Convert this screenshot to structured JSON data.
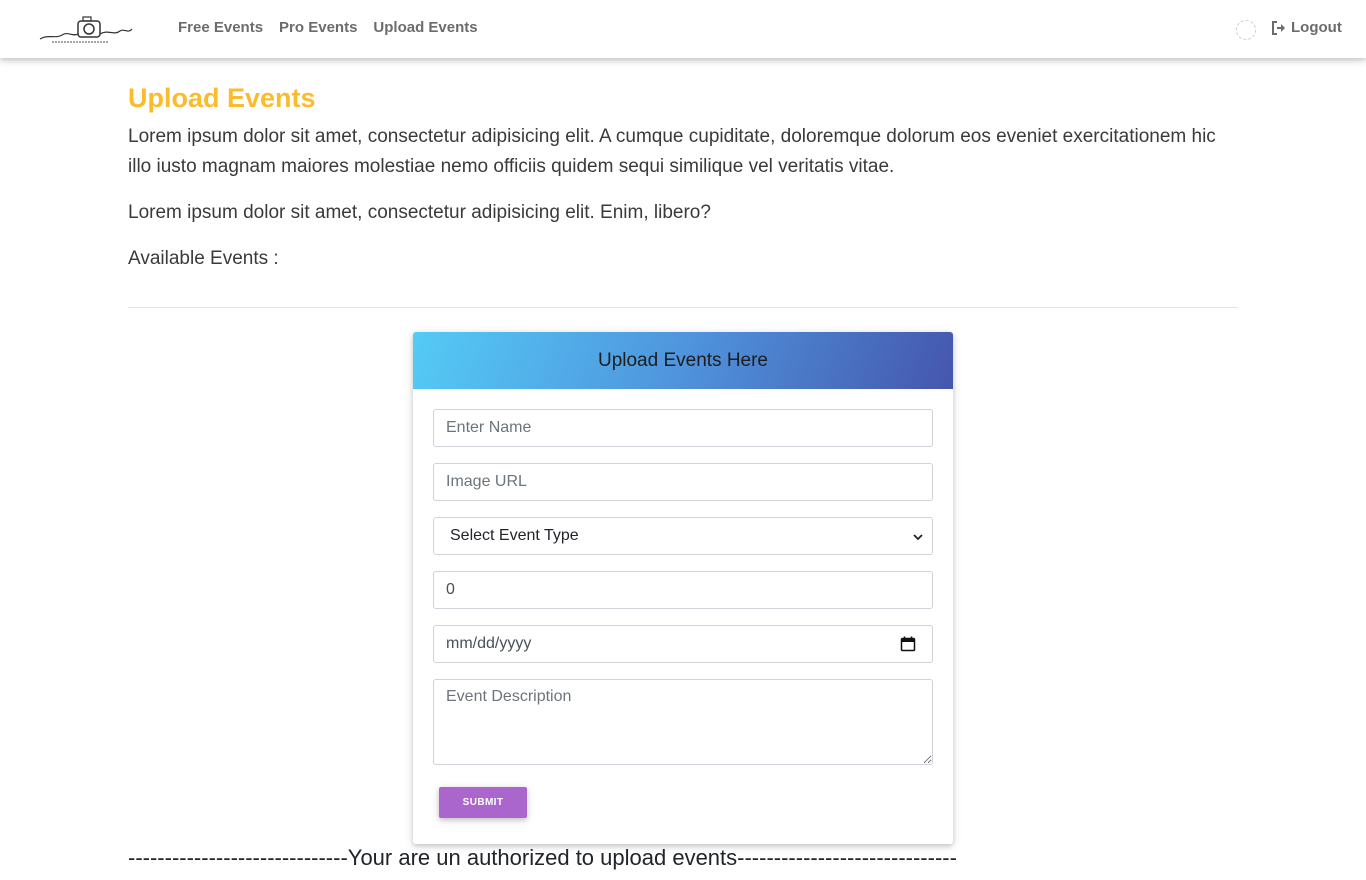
{
  "nav": {
    "logo_text": "pawan photography",
    "links": [
      {
        "label": "Free Events"
      },
      {
        "label": "Pro Events"
      },
      {
        "label": "Upload Events"
      }
    ],
    "avatar_icon": "avatar-placeholder-icon",
    "logout_label": "Logout",
    "logout_icon": "sign-out-icon"
  },
  "page": {
    "title": "Upload Events",
    "paragraph1": "Lorem ipsum dolor sit amet, consectetur adipisicing elit. A cumque cupiditate, doloremque dolorum eos eveniet exercitationem hic illo iusto magnam maiores molestiae nemo officiis quidem sequi similique vel veritatis vitae.",
    "paragraph2": "Lorem ipsum dolor sit amet, consectetur adipisicing elit. Enim, libero?",
    "paragraph3": "Available Events :"
  },
  "form": {
    "header": "Upload Events Here",
    "name_placeholder": "Enter Name",
    "image_placeholder": "Image URL",
    "event_type_selected": "Select Event Type",
    "price_value": "0",
    "date_placeholder": "mm/dd/yyyy",
    "description_placeholder": "Event Description",
    "submit_label": "SUBMIT"
  },
  "footer_message": "------------------------------Your are un authorized to upload events------------------------------",
  "colors": {
    "title": "#fbbc2c",
    "submit": "#aa66cc",
    "header_gradient_start": "#54cbf6",
    "header_gradient_end": "#4556ad"
  }
}
